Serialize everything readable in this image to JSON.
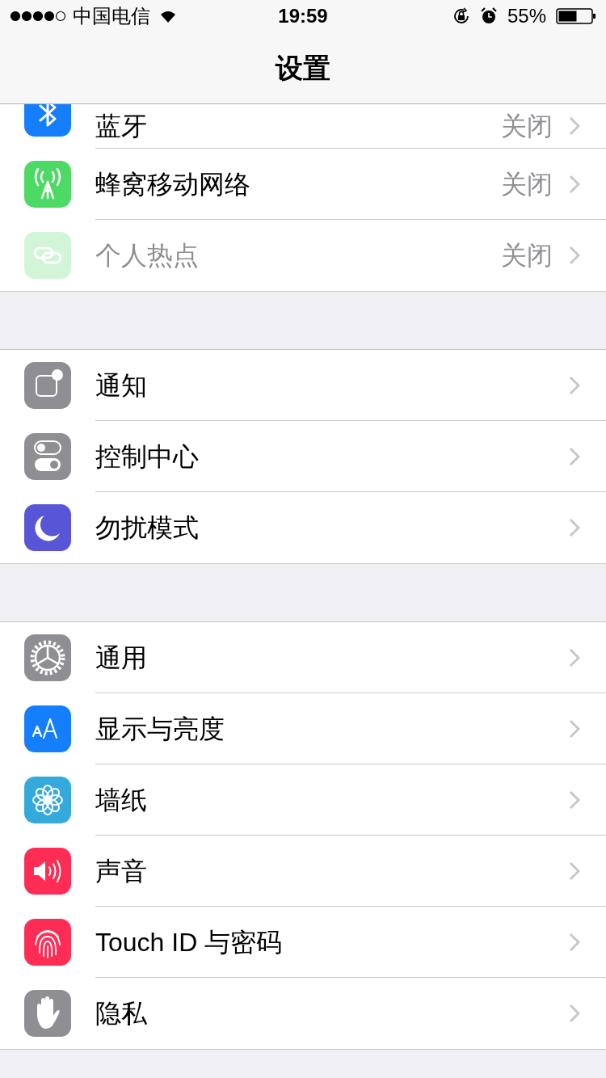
{
  "status_bar": {
    "carrier": "中国电信",
    "time": "19:59",
    "battery": "55%"
  },
  "nav": {
    "title": "设置"
  },
  "groups": [
    {
      "items": [
        {
          "kind": "bluetooth",
          "label": "蓝牙",
          "value": "关闭",
          "disabled": false,
          "clipped": true
        },
        {
          "kind": "cellular",
          "label": "蜂窝移动网络",
          "value": "关闭",
          "disabled": false,
          "clipped": false
        },
        {
          "kind": "hotspot",
          "label": "个人热点",
          "value": "关闭",
          "disabled": true,
          "clipped": false
        }
      ]
    },
    {
      "items": [
        {
          "kind": "notifications",
          "label": "通知",
          "disabled": false,
          "clipped": false
        },
        {
          "kind": "control",
          "label": "控制中心",
          "disabled": false,
          "clipped": false
        },
        {
          "kind": "dnd",
          "label": "勿扰模式",
          "disabled": false,
          "clipped": false
        }
      ]
    },
    {
      "items": [
        {
          "kind": "general",
          "label": "通用",
          "disabled": false,
          "clipped": false
        },
        {
          "kind": "display",
          "label": "显示与亮度",
          "disabled": false,
          "clipped": false
        },
        {
          "kind": "wallpaper",
          "label": "墙纸",
          "disabled": false,
          "clipped": false
        },
        {
          "kind": "sounds",
          "label": "声音",
          "disabled": false,
          "clipped": false
        },
        {
          "kind": "touchid",
          "label": "Touch ID 与密码",
          "disabled": false,
          "clipped": false
        },
        {
          "kind": "privacy",
          "label": "隐私",
          "disabled": false,
          "clipped": false
        }
      ]
    }
  ]
}
